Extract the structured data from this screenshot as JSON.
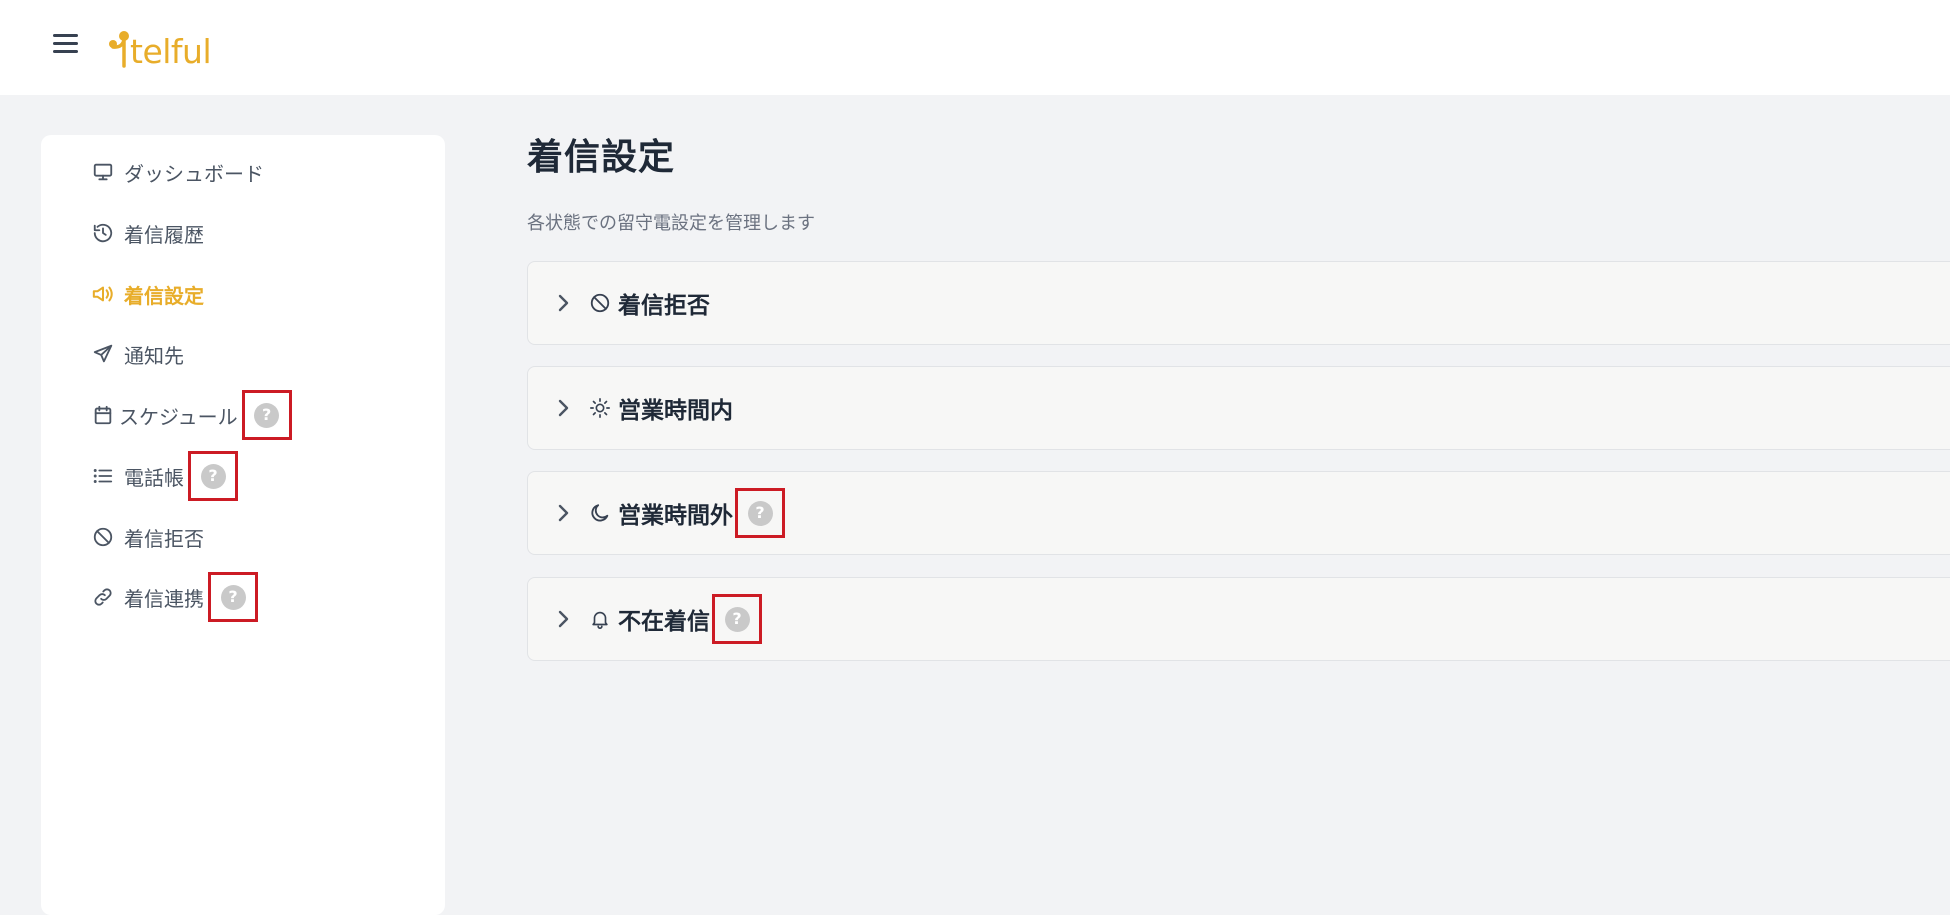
{
  "header": {
    "logo_text": "telful",
    "menu_icon": "hamburger-menu-icon",
    "brand_color": "#e8ad2a"
  },
  "sidebar": {
    "items": [
      {
        "label": "ダッシュボード",
        "icon": "monitor-icon",
        "active": false,
        "help": false
      },
      {
        "label": "着信履歴",
        "icon": "history-icon",
        "active": false,
        "help": false
      },
      {
        "label": "着信設定",
        "icon": "megaphone-icon",
        "active": true,
        "help": false
      },
      {
        "label": "通知先",
        "icon": "send-icon",
        "active": false,
        "help": false
      },
      {
        "label": "スケジュール",
        "icon": "calendar-icon",
        "active": false,
        "help": true
      },
      {
        "label": "電話帳",
        "icon": "list-icon",
        "active": false,
        "help": true
      },
      {
        "label": "着信拒否",
        "icon": "ban-icon",
        "active": false,
        "help": false
      },
      {
        "label": "着信連携",
        "icon": "link-icon",
        "active": false,
        "help": true
      }
    ]
  },
  "main": {
    "title": "着信設定",
    "subtitle": "各状態での留守電設定を管理します",
    "sections": [
      {
        "label": "着信拒否",
        "icon": "ban-icon",
        "help": false
      },
      {
        "label": "営業時間内",
        "icon": "sun-icon",
        "help": false
      },
      {
        "label": "営業時間外",
        "icon": "moon-icon",
        "help": true
      },
      {
        "label": "不在着信",
        "icon": "bell-icon",
        "help": true
      }
    ]
  },
  "help_icon_glyph": "?",
  "colors": {
    "accent": "#e8ad2a",
    "highlight_box": "#cc1b24",
    "help_icon": "#c9c9c9"
  }
}
